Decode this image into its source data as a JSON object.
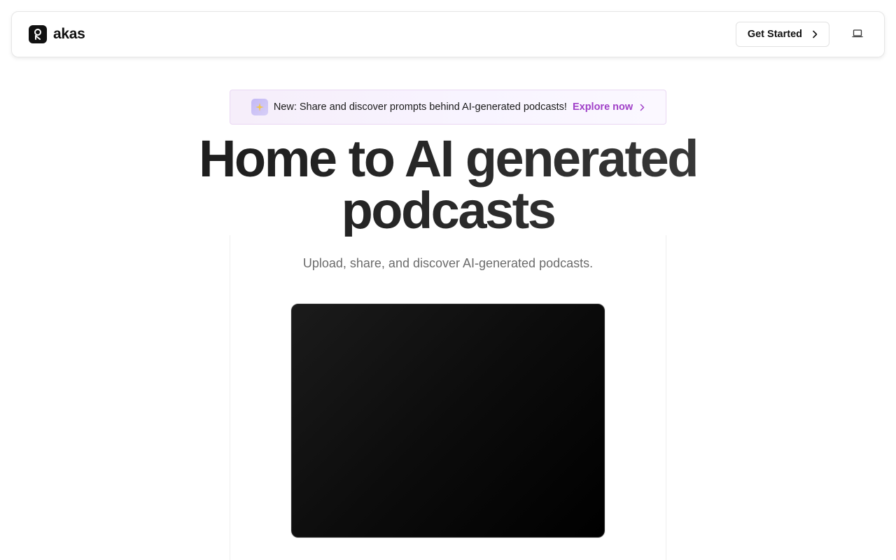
{
  "brand": {
    "name": "akas",
    "logo_icon": "akas-logo-icon"
  },
  "nav": {
    "cta_label": "Get Started",
    "cta_icon": "chevron-right-icon",
    "theme_icon": "laptop-icon"
  },
  "announcement": {
    "icon": "sparkle-icon",
    "text": "New: Share and discover prompts behind AI-generated podcasts!",
    "link_label": "Explore now",
    "link_icon": "chevron-right-icon",
    "accent": "#a040c8"
  },
  "hero": {
    "title_line1": "Home to AI generated",
    "title_line2": "podcasts",
    "subtitle": "Upload, share, and discover AI-generated podcasts."
  },
  "colors": {
    "text": "#111111",
    "muted": "#6b6b6b",
    "media_bg": "#0c0c0c"
  }
}
